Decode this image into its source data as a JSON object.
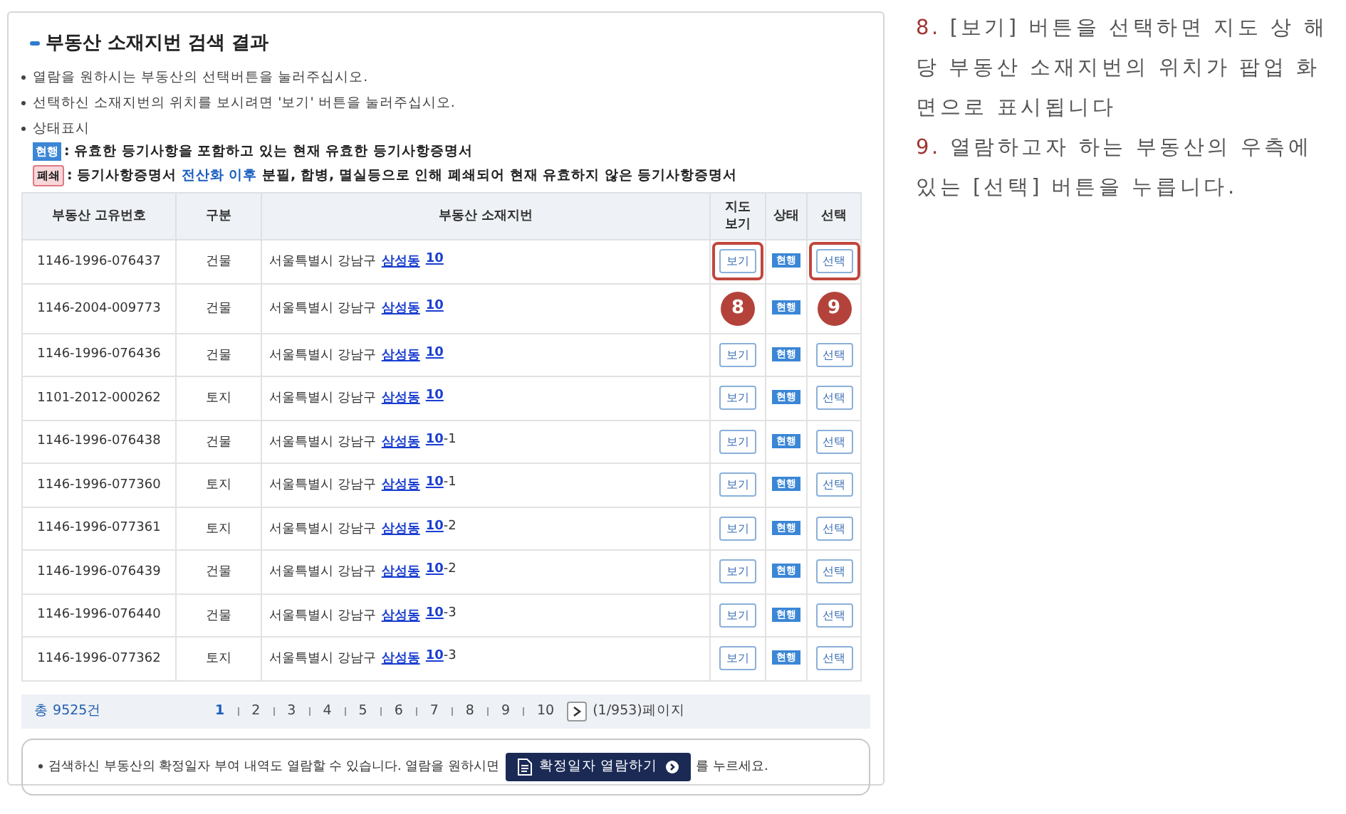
{
  "panel": {
    "title": "부동산 소재지번 검색 결과",
    "notes": [
      "열람을 원하시는 부동산의 선택버튼을 눌러주십시오.",
      "선택하신 소재지번의 위치를 보시려면 '보기' 버튼을 눌러주십시오.",
      "상태표시"
    ],
    "legend": [
      {
        "kind": "current",
        "badge": "현행",
        "text": ": 유효한 등기사항을 포함하고 있는 현재 유효한 등기사항증명서"
      },
      {
        "kind": "closed",
        "badge": "폐쇄",
        "text": ": 등기사항증명서 **전산화 이후** 분필, 합병, 멸실등으로 인해 폐쇄되어 현재 유효하지 않은 등기사항증명서"
      }
    ]
  },
  "table": {
    "columns": [
      "부동산 고유번호",
      "구분",
      "부동산 소재지번",
      "지도\n보기",
      "상태",
      "선택"
    ],
    "rows": [
      {
        "id": "1146-1996-076437",
        "type": "건물",
        "address": "서울특별시 강남구",
        "dong": "삼성동",
        "lot": "10",
        "view": "보기",
        "status": "현행",
        "select": "선택",
        "marked": true
      },
      {
        "id": "1146-2004-009773",
        "type": "건물",
        "address": "서울특별시 강남구",
        "dong": "삼성동",
        "lot": "10",
        "status": "현행",
        "view_callout": "8",
        "select_callout": "9",
        "marked": false
      },
      {
        "id": "1146-1996-076436",
        "type": "건물",
        "address": "서울특별시 강남구",
        "dong": "삼성동",
        "lot": "10",
        "view": "보기",
        "status": "현행",
        "select": "선택",
        "marked": false
      },
      {
        "id": "1101-2012-000262",
        "type": "토지",
        "address": "서울특별시 강남구",
        "dong": "삼성동",
        "lot": "10",
        "view": "보기",
        "status": "현행",
        "select": "선택",
        "marked": false
      },
      {
        "id": "1146-1996-076438",
        "type": "건물",
        "address": "서울특별시 강남구",
        "dong": "삼성동",
        "lot": "10",
        "suffix": "-1",
        "view": "보기",
        "status": "현행",
        "select": "선택",
        "marked": false
      },
      {
        "id": "1146-1996-077360",
        "type": "토지",
        "address": "서울특별시 강남구",
        "dong": "삼성동",
        "lot": "10",
        "suffix": "-1",
        "view": "보기",
        "status": "현행",
        "select": "선택",
        "marked": false
      },
      {
        "id": "1146-1996-077361",
        "type": "토지",
        "address": "서울특별시 강남구",
        "dong": "삼성동",
        "lot": "10",
        "suffix": "-2",
        "view": "보기",
        "status": "현행",
        "select": "선택",
        "marked": false
      },
      {
        "id": "1146-1996-076439",
        "type": "건물",
        "address": "서울특별시 강남구",
        "dong": "삼성동",
        "lot": "10",
        "suffix": "-2",
        "view": "보기",
        "status": "현행",
        "select": "선택",
        "marked": false
      },
      {
        "id": "1146-1996-076440",
        "type": "건물",
        "address": "서울특별시 강남구",
        "dong": "삼성동",
        "lot": "10",
        "suffix": "-3",
        "view": "보기",
        "status": "현행",
        "select": "선택",
        "marked": false
      },
      {
        "id": "1146-1996-077362",
        "type": "토지",
        "address": "서울특별시 강남구",
        "dong": "삼성동",
        "lot": "10",
        "suffix": "-3",
        "view": "보기",
        "status": "현행",
        "select": "선택",
        "marked": false
      }
    ]
  },
  "pagination": {
    "total": "총 9525건",
    "pages": [
      {
        "label": "1",
        "selected": true
      },
      {
        "label": "2",
        "selected": false
      },
      {
        "label": "3",
        "selected": false
      },
      {
        "label": "4",
        "selected": false
      },
      {
        "label": "5",
        "selected": false
      },
      {
        "label": "6",
        "selected": false
      },
      {
        "label": "7",
        "selected": false
      },
      {
        "label": "8",
        "selected": false
      },
      {
        "label": "9",
        "selected": false
      },
      {
        "label": "10",
        "selected": false
      }
    ],
    "page_info": "(1/953)페이지"
  },
  "notice": {
    "before": "검색하신 부동산의 확정일자 부여 내역도 열람할 수 있습니다. 열람을 원하시면",
    "button": "확정일자 열람하기",
    "after": "를 누르세요."
  },
  "instructions": [
    {
      "number": "8.",
      "text": "[보기] 버튼을 선택하면 지도 상 해당 부동산 소재지번의 위치가 팝업 화면으로 표시됩니다"
    },
    {
      "number": "9.",
      "text": "열람하고자 하는 부동산의 우측에 있는 [선택] 버튼을 누릅니다."
    }
  ]
}
